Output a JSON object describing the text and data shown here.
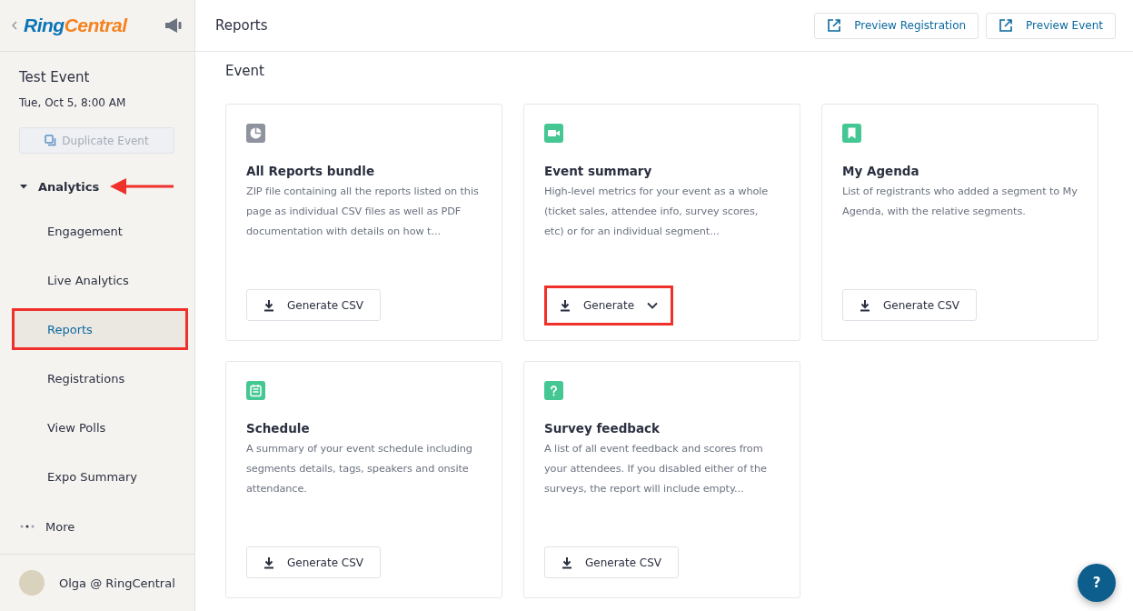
{
  "sidebar": {
    "logo_first": "Ring",
    "logo_second": "Central",
    "event_title": "Test Event",
    "event_date": "Tue, Oct 5, 8:00 AM",
    "duplicate_button": {
      "label": "Duplicate Event",
      "disabled": true
    },
    "section": {
      "label": "Analytics",
      "expanded": true,
      "pointed": true
    },
    "items": [
      {
        "label": "Engagement",
        "selected": false,
        "highlighted": false
      },
      {
        "label": "Live Analytics",
        "selected": false,
        "highlighted": false
      },
      {
        "label": "Reports",
        "selected": true,
        "highlighted": true
      },
      {
        "label": "Registrations",
        "selected": false,
        "highlighted": false
      },
      {
        "label": "View Polls",
        "selected": false,
        "highlighted": false
      },
      {
        "label": "Expo Summary",
        "selected": false,
        "highlighted": false
      }
    ],
    "more": "More",
    "user": "Olga @ RingCentral"
  },
  "header": {
    "title": "Reports",
    "buttons": [
      "Preview Registration",
      "Preview Event"
    ]
  },
  "section_title": "Event",
  "cards": [
    {
      "kind": "pie",
      "color": "#8e939e",
      "title": "All Reports bundle",
      "description": "ZIP file containing all the reports listed on this page as individual CSV files as well as PDF documentation with details on how t...",
      "button": {
        "kind": "plain",
        "label": "Generate CSV",
        "highlighted": false
      }
    },
    {
      "kind": "video",
      "color": "#45c794",
      "title": "Event summary",
      "description": "High-level metrics for your event as a whole (ticket sales, attendee info, survey scores, etc) or for an individual segment...",
      "button": {
        "kind": "dropdown",
        "label": "Generate",
        "highlighted": true
      }
    },
    {
      "kind": "bookmark",
      "color": "#45c794",
      "title": "My Agenda",
      "description": "List of registrants who added a segment to My Agenda, with the relative segments.",
      "button": {
        "kind": "plain",
        "label": "Generate CSV",
        "highlighted": false
      }
    },
    {
      "kind": "calendar",
      "color": "#45c794",
      "title": "Schedule",
      "description": "A summary of your event schedule including segments details, tags, speakers and onsite attendance.",
      "button": {
        "kind": "plain",
        "label": "Generate CSV",
        "highlighted": false
      }
    },
    {
      "kind": "question",
      "color": "#45c794",
      "title": "Survey feedback",
      "description": "A list of all event feedback and scores from your attendees. If you disabled either of the surveys, the report will include empty...",
      "button": {
        "kind": "plain",
        "label": "Generate CSV",
        "highlighted": false
      }
    }
  ],
  "help_button": "?"
}
